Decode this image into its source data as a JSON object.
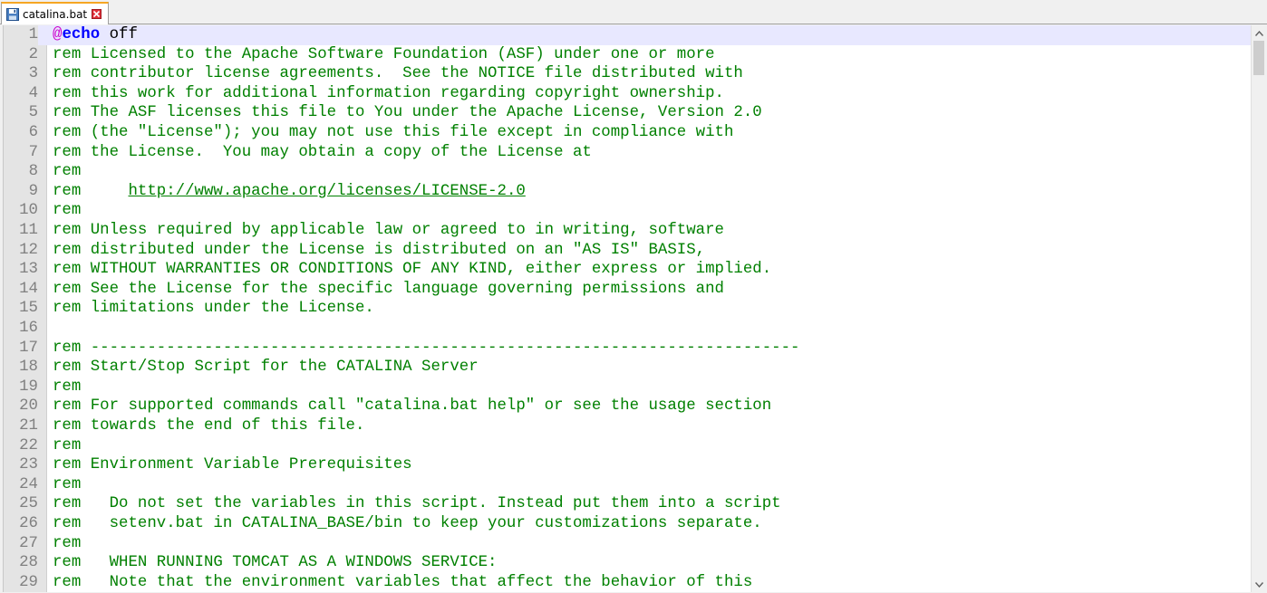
{
  "tab": {
    "label": "catalina.bat",
    "icon": "save-disk-icon",
    "close_icon": "close-icon",
    "accent": "#f5a623",
    "close_color": "#e0303a"
  },
  "colors": {
    "comment": "#008000",
    "at_symbol": "#cc00cc",
    "keyword": "#0000ff",
    "line_number": "#808080",
    "current_line": "#e8e8ff"
  },
  "editor": {
    "current_line": 1,
    "lines": [
      {
        "n": "1",
        "segments": [
          {
            "text": "@",
            "style": "at"
          },
          {
            "text": "echo",
            "style": "keyword"
          },
          {
            "text": " off",
            "style": "plain"
          }
        ]
      },
      {
        "n": "2",
        "segments": [
          {
            "text": "rem Licensed to the Apache Software Foundation (ASF) under one or more",
            "style": "comment"
          }
        ]
      },
      {
        "n": "3",
        "segments": [
          {
            "text": "rem contributor license agreements.  See the NOTICE file distributed with",
            "style": "comment"
          }
        ]
      },
      {
        "n": "4",
        "segments": [
          {
            "text": "rem this work for additional information regarding copyright ownership.",
            "style": "comment"
          }
        ]
      },
      {
        "n": "5",
        "segments": [
          {
            "text": "rem The ASF licenses this file to You under the Apache License, Version 2.0",
            "style": "comment"
          }
        ]
      },
      {
        "n": "6",
        "segments": [
          {
            "text": "rem (the \"License\"); you may not use this file except in compliance with",
            "style": "comment"
          }
        ]
      },
      {
        "n": "7",
        "segments": [
          {
            "text": "rem the License.  You may obtain a copy of the License at",
            "style": "comment"
          }
        ]
      },
      {
        "n": "8",
        "segments": [
          {
            "text": "rem",
            "style": "comment"
          }
        ]
      },
      {
        "n": "9",
        "segments": [
          {
            "text": "rem     ",
            "style": "comment"
          },
          {
            "text": "http://www.apache.org/licenses/LICENSE-2.0",
            "style": "url"
          }
        ]
      },
      {
        "n": "10",
        "segments": [
          {
            "text": "rem",
            "style": "comment"
          }
        ]
      },
      {
        "n": "11",
        "segments": [
          {
            "text": "rem Unless required by applicable law or agreed to in writing, software",
            "style": "comment"
          }
        ]
      },
      {
        "n": "12",
        "segments": [
          {
            "text": "rem distributed under the License is distributed on an \"AS IS\" BASIS,",
            "style": "comment"
          }
        ]
      },
      {
        "n": "13",
        "segments": [
          {
            "text": "rem WITHOUT WARRANTIES OR CONDITIONS OF ANY KIND, either express or implied.",
            "style": "comment"
          }
        ]
      },
      {
        "n": "14",
        "segments": [
          {
            "text": "rem See the License for the specific language governing permissions and",
            "style": "comment"
          }
        ]
      },
      {
        "n": "15",
        "segments": [
          {
            "text": "rem limitations under the License.",
            "style": "comment"
          }
        ]
      },
      {
        "n": "16",
        "segments": []
      },
      {
        "n": "17",
        "segments": [
          {
            "text": "rem ---------------------------------------------------------------------------",
            "style": "comment"
          }
        ]
      },
      {
        "n": "18",
        "segments": [
          {
            "text": "rem Start/Stop Script for the CATALINA Server",
            "style": "comment"
          }
        ]
      },
      {
        "n": "19",
        "segments": [
          {
            "text": "rem",
            "style": "comment"
          }
        ]
      },
      {
        "n": "20",
        "segments": [
          {
            "text": "rem For supported commands call \"catalina.bat help\" or see the usage section",
            "style": "comment"
          }
        ]
      },
      {
        "n": "21",
        "segments": [
          {
            "text": "rem towards the end of this file.",
            "style": "comment"
          }
        ]
      },
      {
        "n": "22",
        "segments": [
          {
            "text": "rem",
            "style": "comment"
          }
        ]
      },
      {
        "n": "23",
        "segments": [
          {
            "text": "rem Environment Variable Prerequisites",
            "style": "comment"
          }
        ]
      },
      {
        "n": "24",
        "segments": [
          {
            "text": "rem",
            "style": "comment"
          }
        ]
      },
      {
        "n": "25",
        "segments": [
          {
            "text": "rem   Do not set the variables in this script. Instead put them into a script",
            "style": "comment"
          }
        ]
      },
      {
        "n": "26",
        "segments": [
          {
            "text": "rem   setenv.bat in CATALINA_BASE/bin to keep your customizations separate.",
            "style": "comment"
          }
        ]
      },
      {
        "n": "27",
        "segments": [
          {
            "text": "rem",
            "style": "comment"
          }
        ]
      },
      {
        "n": "28",
        "segments": [
          {
            "text": "rem   WHEN RUNNING TOMCAT AS A WINDOWS SERVICE:",
            "style": "comment"
          }
        ]
      },
      {
        "n": "29",
        "segments": [
          {
            "text": "rem   Note that the environment variables that affect the behavior of this",
            "style": "comment"
          }
        ]
      }
    ]
  },
  "scrollbar": {
    "up_icon": "chevron-up-icon",
    "down_icon": "chevron-down-icon",
    "position": 0
  }
}
